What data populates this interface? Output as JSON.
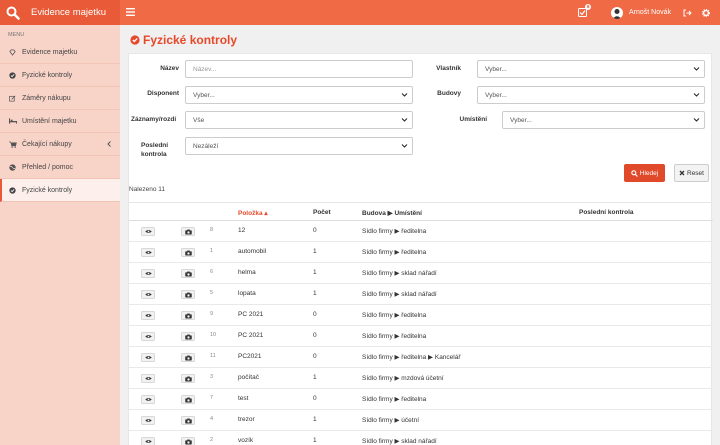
{
  "app": {
    "title": "Evidence majetku",
    "task_badge": "6",
    "user_name": "Arnošt Novák"
  },
  "sidebar": {
    "menu_label": "MENU",
    "items": [
      {
        "label": "Evidence majetku",
        "icon": "diamond-icon"
      },
      {
        "label": "Fyzické kontroly",
        "icon": "check-circle-icon"
      },
      {
        "label": "Záměry nákupu",
        "icon": "edit-icon"
      },
      {
        "label": "Umístění majetku",
        "icon": "bed-icon"
      },
      {
        "label": "Čekající nákupy",
        "icon": "cart-icon"
      },
      {
        "label": "Přehled / pomoc",
        "icon": "globe-icon"
      },
      {
        "label": "Fyzické kontroly",
        "icon": "check-circle-icon"
      }
    ]
  },
  "page": {
    "title": "Fyzické kontroly"
  },
  "filters": {
    "nazev": {
      "label": "Název",
      "placeholder": "Název..."
    },
    "vlastnik": {
      "label": "Vlastník",
      "value": "Vyber..."
    },
    "disponent": {
      "label": "Disponent",
      "value": "Vyber..."
    },
    "budovy": {
      "label": "Budovy",
      "value": "Vyber..."
    },
    "zaznamy": {
      "label": "Záznamy/rozdí",
      "value": "Vše"
    },
    "umisteni": {
      "label": "Umístění",
      "value": "Vyber..."
    },
    "posledni": {
      "label_line1": "Poslední",
      "label_line2": "kontrola",
      "value": "Nezáleží"
    },
    "search_label": "Hledej",
    "reset_label": "Reset"
  },
  "result": {
    "found_text": "Nalezeno 11"
  },
  "table": {
    "headers": {
      "polozka": "Položka ▴",
      "pocet": "Počet",
      "budova": "Budova ▶ Umístění",
      "posledni": "Poslední kontrola"
    },
    "rows": [
      {
        "id": "8",
        "polozka": "12",
        "pocet": "0",
        "umisteni": "Sídlo firmy ▶ ředitelna",
        "posledni": ""
      },
      {
        "id": "1",
        "polozka": "automobil",
        "pocet": "1",
        "umisteni": "Sídlo firmy ▶ ředitelna",
        "posledni": ""
      },
      {
        "id": "6",
        "polozka": "helma",
        "pocet": "1",
        "umisteni": "Sídlo firmy ▶ sklad nářadí",
        "posledni": ""
      },
      {
        "id": "5",
        "polozka": "lopata",
        "pocet": "1",
        "umisteni": "Sídlo firmy ▶ sklad nářadí",
        "posledni": ""
      },
      {
        "id": "9",
        "polozka": "PC 2021",
        "pocet": "0",
        "umisteni": "Sídlo firmy ▶ ředitelna",
        "posledni": ""
      },
      {
        "id": "10",
        "polozka": "PC 2021",
        "pocet": "0",
        "umisteni": "Sídlo firmy ▶ ředitelna",
        "posledni": ""
      },
      {
        "id": "11",
        "polozka": "PC2021",
        "pocet": "0",
        "umisteni": "Sídlo firmy ▶ ředitelna ▶ Kancelář",
        "posledni": ""
      },
      {
        "id": "3",
        "polozka": "počítač",
        "pocet": "1",
        "umisteni": "Sídlo firmy ▶ mzdová účetní",
        "posledni": ""
      },
      {
        "id": "7",
        "polozka": "test",
        "pocet": "0",
        "umisteni": "Sídlo firmy ▶ ředitelna",
        "posledni": ""
      },
      {
        "id": "4",
        "polozka": "trezor",
        "pocet": "1",
        "umisteni": "Sídlo firmy ▶ účetní",
        "posledni": ""
      },
      {
        "id": "2",
        "polozka": "vozík",
        "pocet": "1",
        "umisteni": "Sídlo firmy ▶ sklad nářadí",
        "posledni": ""
      }
    ]
  },
  "colors": {
    "accent": "#e8482a",
    "topbar": "#ef6a45",
    "sidebar": "#f8d3c8"
  }
}
